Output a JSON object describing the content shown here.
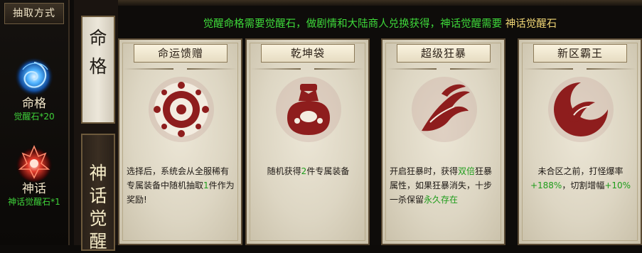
{
  "left_panel": {
    "title": "抽取方式",
    "items": [
      {
        "name": "命格",
        "cost": "觉醒石*20",
        "icon": "blue-vortex-icon"
      },
      {
        "name": "神话",
        "cost": "神话觉醒石*1",
        "icon": "red-flame-icon"
      }
    ]
  },
  "tabs": [
    {
      "label": [
        "命",
        "格"
      ],
      "active": true
    },
    {
      "label": [
        "神",
        "话",
        "觉",
        "醒"
      ],
      "active": false
    }
  ],
  "notice": {
    "text": "觉醒命格需要觉醒石，做剧情和大陆商人兑换获得，神话觉醒需要",
    "highlight": "神话觉醒石"
  },
  "cards": [
    {
      "title": "命运馈赠",
      "icon": "sun-burst-icon",
      "desc_parts": [
        "选择后，系统会从全服稀有专属装备中随机抽取",
        "1",
        "件作为奖励!"
      ]
    },
    {
      "title": "乾坤袋",
      "icon": "treasure-bag-icon",
      "desc_parts": [
        "随机获得",
        "2",
        "件专属装备"
      ]
    },
    {
      "title": "超级狂暴",
      "icon": "rage-claw-icon",
      "desc_parts": [
        "开启狂暴时，获得",
        "双倍",
        "狂暴属性，如果狂暴消失，十步一杀保留",
        "永久存在"
      ]
    },
    {
      "title": "新区霸王",
      "icon": "crescent-swirl-icon",
      "desc_parts": [
        "未合区之前，打怪爆率",
        "+188%",
        "，切割增幅",
        "+10%"
      ]
    }
  ],
  "colors": {
    "accent_green": "#3ed93a",
    "highlight_gold": "#f0d675",
    "emblem_red": "#8e1d1d"
  }
}
